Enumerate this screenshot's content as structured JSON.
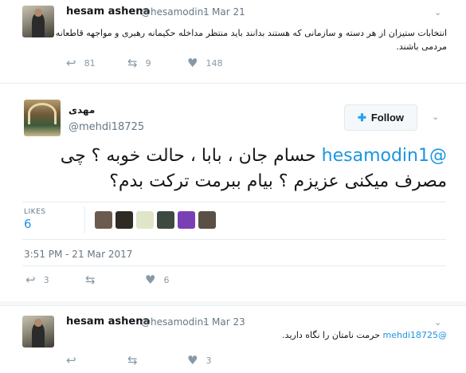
{
  "tweet1": {
    "name": "hesam ashena",
    "handle": "@hesamodin1",
    "separator": "·",
    "date": "Mar 21",
    "text": "انتخابات ستیزان از هر دسته و سازمانی که هستند بدانند باید منتظر  مداخله حکیمانه رهبری و مواجهه قاطعانه مردمی باشند.",
    "replies": "81",
    "retweets": "9",
    "likes": "148"
  },
  "tweet2": {
    "name": "مهدی",
    "handle": "@mehdi18725",
    "follow_label": "Follow",
    "mention": "@hesamodin1",
    "text": " حسام جان ، بابا ، حالت خوبه ؟ چی مصرف میکنی عزیزم ؟ بیام ببرمت ترکت بدم؟",
    "likes_label": "LIKES",
    "likes_count": "6",
    "timestamp": "3:51 PM - 21 Mar 2017",
    "replies": "3",
    "retweets": "",
    "likes": "6",
    "liker_colors": [
      "#6b5a4e",
      "#2f2a24",
      "#dfe6c8",
      "#3c4a40",
      "#7b3fb5",
      "#5a5046"
    ]
  },
  "tweet3": {
    "name": "hesam ashena",
    "handle": "@hesamodin1",
    "separator": "·",
    "date": "Mar 23",
    "mention": "@mehdi18725",
    "text": " حرمت نامتان را نگاه دارید.",
    "replies": "",
    "retweets": "",
    "likes": "3"
  },
  "icons": {
    "reply": "reply-icon",
    "retweet": "retweet-icon",
    "like": "heart-icon",
    "more": "chevron-down-icon",
    "follow": "add-user-icon"
  },
  "colors": {
    "link": "#1b95e0",
    "muted": "#657786",
    "icon": "#8899a6"
  }
}
